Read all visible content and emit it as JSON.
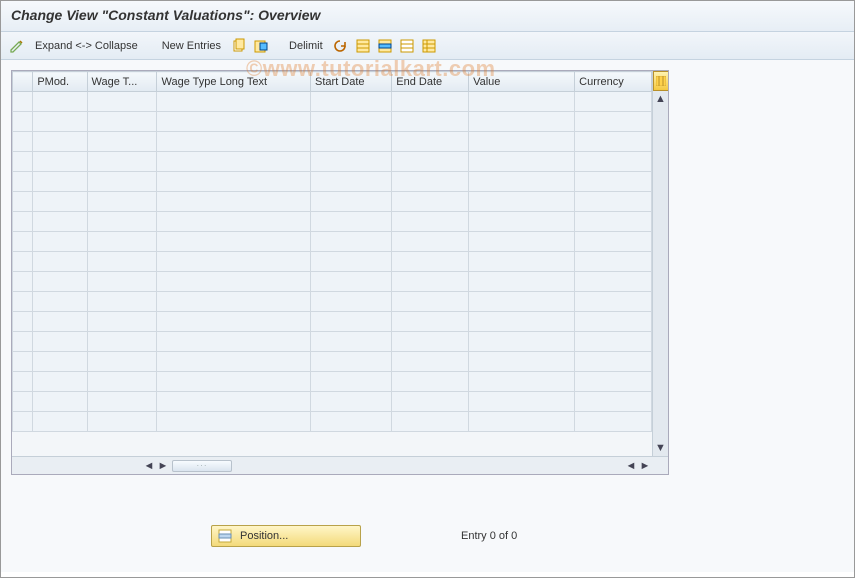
{
  "watermark": "©www.tutorialkart.com",
  "title": "Change View \"Constant Valuations\": Overview",
  "toolbar": {
    "expand_collapse": "Expand <-> Collapse",
    "new_entries": "New Entries",
    "delimit": "Delimit"
  },
  "table": {
    "columns": [
      "PMod.",
      "Wage T...",
      "Wage Type Long Text",
      "Start Date",
      "End Date",
      "Value",
      "Currency"
    ],
    "rows": [
      {},
      {},
      {},
      {},
      {},
      {},
      {},
      {},
      {},
      {},
      {},
      {},
      {},
      {},
      {},
      {},
      {}
    ]
  },
  "footer": {
    "position_label": "Position...",
    "entry_text": "Entry 0 of 0"
  }
}
